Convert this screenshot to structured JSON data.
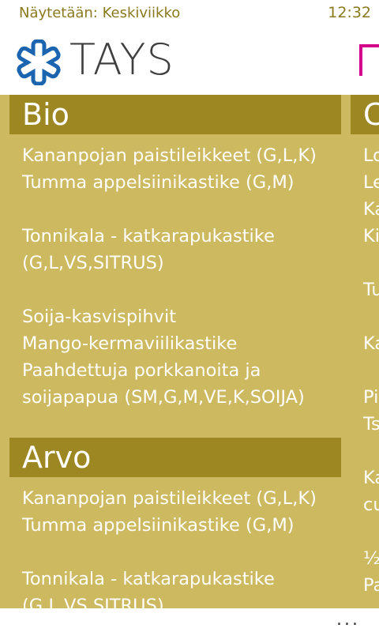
{
  "status": {
    "day": "Näytetään: Keskiviikko",
    "time": "12:32"
  },
  "header": {
    "title": "TAYS",
    "logo_icon": "star-of-life-icon"
  },
  "colors": {
    "background": "#cdb95f",
    "section_header": "#9c8722",
    "status_text": "#8a7a1f",
    "accent": "#d3008a"
  },
  "main": {
    "sections": [
      {
        "name": "Bio",
        "meals": [
          [
            "Kananpojan paistileikkeet (G,L,K)",
            "Tumma appelsiinikastike (G,M)"
          ],
          [
            "Tonnikala - katkarapukastike",
            "(G,L,VS,SITRUS)"
          ],
          [
            "Soija-kasvispihvit",
            "Mango-kermaviilikastike",
            "Paahdettuja porkkanoita ja",
            "soijapapua (SM,G,M,VE,K,SOIJA)"
          ]
        ]
      },
      {
        "name": "Arvo",
        "meals": [
          [
            "Kananpojan paistileikkeet (G,L,K)",
            "Tumma appelsiinikastike (G,M)"
          ],
          [
            "Tonnikala - katkarapukastike",
            "(G,L,VS,SITRUS)"
          ]
        ]
      }
    ]
  },
  "peek": {
    "header_fragment": "C",
    "meals": [
      [
        "Lo",
        "Le",
        "Ka",
        "Ki"
      ],
      [
        "Tu"
      ],
      [
        "Ka"
      ],
      [
        "Pi",
        "Ts"
      ],
      [
        "Ka",
        "cu"
      ],
      [
        "½",
        "Pa"
      ]
    ]
  },
  "appbar": {
    "more_label": "..."
  }
}
